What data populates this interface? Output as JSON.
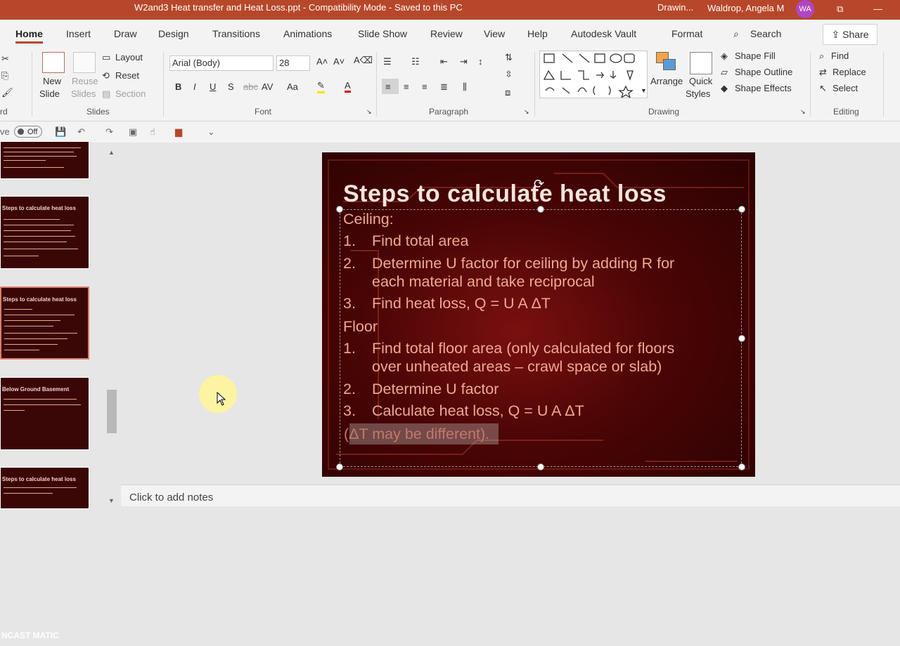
{
  "titlebar": {
    "title": "W2and3 Heat transfer and Heat Loss.ppt  -  Compatibility Mode  -  Saved to this PC",
    "drawing": "Drawin...",
    "user": "Waldrop, Angela M",
    "initials": "WA"
  },
  "tabs": [
    "Home",
    "Insert",
    "Draw",
    "Design",
    "Transitions",
    "Animations",
    "Slide Show",
    "Review",
    "View",
    "Help",
    "Autodesk Vault",
    "Format"
  ],
  "search": "Search",
  "share": "Share",
  "ribbon": {
    "clipboard_label": "rd",
    "slides": {
      "new_slide": "New",
      "new_slide2": "Slide",
      "reuse": "Reuse",
      "reuse2": "Slides",
      "layout": "Layout",
      "reset": "Reset",
      "section": "Section",
      "label": "Slides"
    },
    "font": {
      "name": "Arial (Body)",
      "size": "28",
      "label": "Font",
      "bold": "B",
      "italic": "I",
      "underline": "U",
      "shadow": "S",
      "strike": "abc"
    },
    "paragraph": {
      "label": "Paragraph"
    },
    "drawing": {
      "arrange": "Arrange",
      "quick": "Quick",
      "styles": "Styles",
      "fill": "Shape Fill",
      "outline": "Shape Outline",
      "effects": "Shape Effects",
      "label": "Drawing"
    },
    "editing": {
      "find": "Find",
      "replace": "Replace",
      "select": "Select",
      "label": "Editing"
    }
  },
  "qat": {
    "autosave": "ve",
    "toggle": "Off"
  },
  "thumbnails": [
    {
      "title": ""
    },
    {
      "title": "Steps to calculate heat loss"
    },
    {
      "title": "Steps to calculate heat loss"
    },
    {
      "title": "Below Ground Basement"
    },
    {
      "title": "Steps to calculate heat loss"
    }
  ],
  "slide": {
    "title": "Steps to calculate heat loss",
    "ceiling": "Ceiling:",
    "c1n": "1.",
    "c1": "Find total area",
    "c2n": "2.",
    "c2a": "Determine U factor for ceiling by adding R for",
    "c2b": "each material and take reciprocal",
    "c3n": "3.",
    "c3": "Find heat loss, Q = U A ΔT",
    "floor": "Floor",
    "f1n": "1.",
    "f1a": "Find total floor area (only calculated for floors",
    "f1b": "over unheated areas – crawl space or slab)",
    "f2n": "2.",
    "f2": "Determine U factor",
    "f3n": "3.",
    "f3": "Calculate heat loss, Q = U A ΔT",
    "note": "(ΔT may be different)."
  },
  "notes_placeholder": "Click to add notes",
  "watermark": "NCAST MATIC",
  "colors": {
    "accent": "#b7472a",
    "slide_text": "#f0a892",
    "slide_title": "#f4e4dc"
  }
}
